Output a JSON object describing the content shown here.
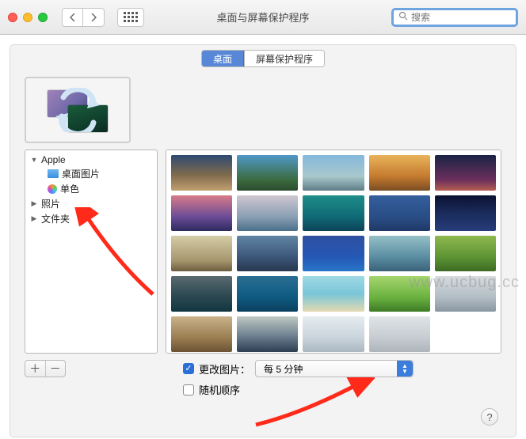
{
  "window": {
    "title": "桌面与屏幕保护程序"
  },
  "search": {
    "placeholder": "搜索"
  },
  "tabs": {
    "desktop": "桌面",
    "screensaver": "屏幕保护程序"
  },
  "sidebar": {
    "root": {
      "label": "Apple",
      "children": {
        "desktopPictures": "桌面图片",
        "solidColors": "单色"
      }
    },
    "photos": "照片",
    "folders": "文件夹"
  },
  "thumbnails": {
    "colors": [
      "linear-gradient(180deg,#2e4a72 0%,#7e6a4d 55%,#c2a06f 100%)",
      "linear-gradient(180deg,#5098c8 0%,#3b6b3f 70%,#2c4a2e 100%)",
      "linear-gradient(180deg,#84b8db 0%,#a8c8cc 60%,#5e7c86 100%)",
      "linear-gradient(180deg,#e8b45a 0%,#c57a2f 60%,#7a4c24 100%)",
      "linear-gradient(180deg,#1a2445 0%,#6c2f5c 70%,#b45f52 100%)",
      "linear-gradient(180deg,#d87c88 0%,#6b4c97 60%,#2d2a5e 100%)",
      "linear-gradient(180deg,#cfc6d1 0%,#8aa0b4 60%,#4a6f8a 100%)",
      "linear-gradient(180deg,#1e8d89 0%,#0f6a76 60%,#0c4258 100%)",
      "linear-gradient(180deg,#345f9e 0%,#284a80 70%,#1f3866 100%)",
      "linear-gradient(180deg,#0b1230 0%,#1a2b5c 50%,#273d7a 100%)",
      "linear-gradient(180deg,#d4cda7 0%,#a6966d 70%,#6c5d3f 100%)",
      "linear-gradient(180deg,#6185a4 0%,#3c567a 60%,#28384e 100%)",
      "linear-gradient(180deg,#2f4fa0 0%,#2458b5 60%,#2876c9 100%)",
      "linear-gradient(180deg,#95c0c6 0%,#5a8da2 60%,#3a6278 100%)",
      "linear-gradient(180deg,#8fb84f 0%,#5d9434 60%,#3d6b23 100%)",
      "linear-gradient(180deg,#5a6a70 0%,#2d4952 55%,#113640 100%)",
      "linear-gradient(180deg,#2a6f92 0%,#0f5a81 60%,#0a3f5e 100%)",
      "linear-gradient(180deg,#9fd9e4 0%,#79c6d8 50%,#e3d9b2 100%)",
      "linear-gradient(180deg,#a6d56f 0%,#6ab240 60%,#3d7a25 100%)",
      "linear-gradient(180deg,#d7dbde 0%,#b2bdc5 60%,#8a97a0 100%)",
      "linear-gradient(180deg,#c9b289 0%,#9a7e52 60%,#6b5233 100%)",
      "linear-gradient(180deg,#bfc9c3 0%,#6c8090 55%,#2d3d52 100%)",
      "linear-gradient(180deg,#e6ecf0 0%,#c9d4dc 60%,#aab7c0 100%)",
      "linear-gradient(180deg,#e0e4e7 0%,#c6ccd1 60%,#adb4ba 100%)"
    ]
  },
  "controls": {
    "plus": "＋",
    "minus": "－",
    "changePicture": "更改图片：",
    "interval": "每 5 分钟",
    "randomOrder": "随机顺序"
  },
  "help": "?",
  "watermark": "www.ucbug.cc"
}
